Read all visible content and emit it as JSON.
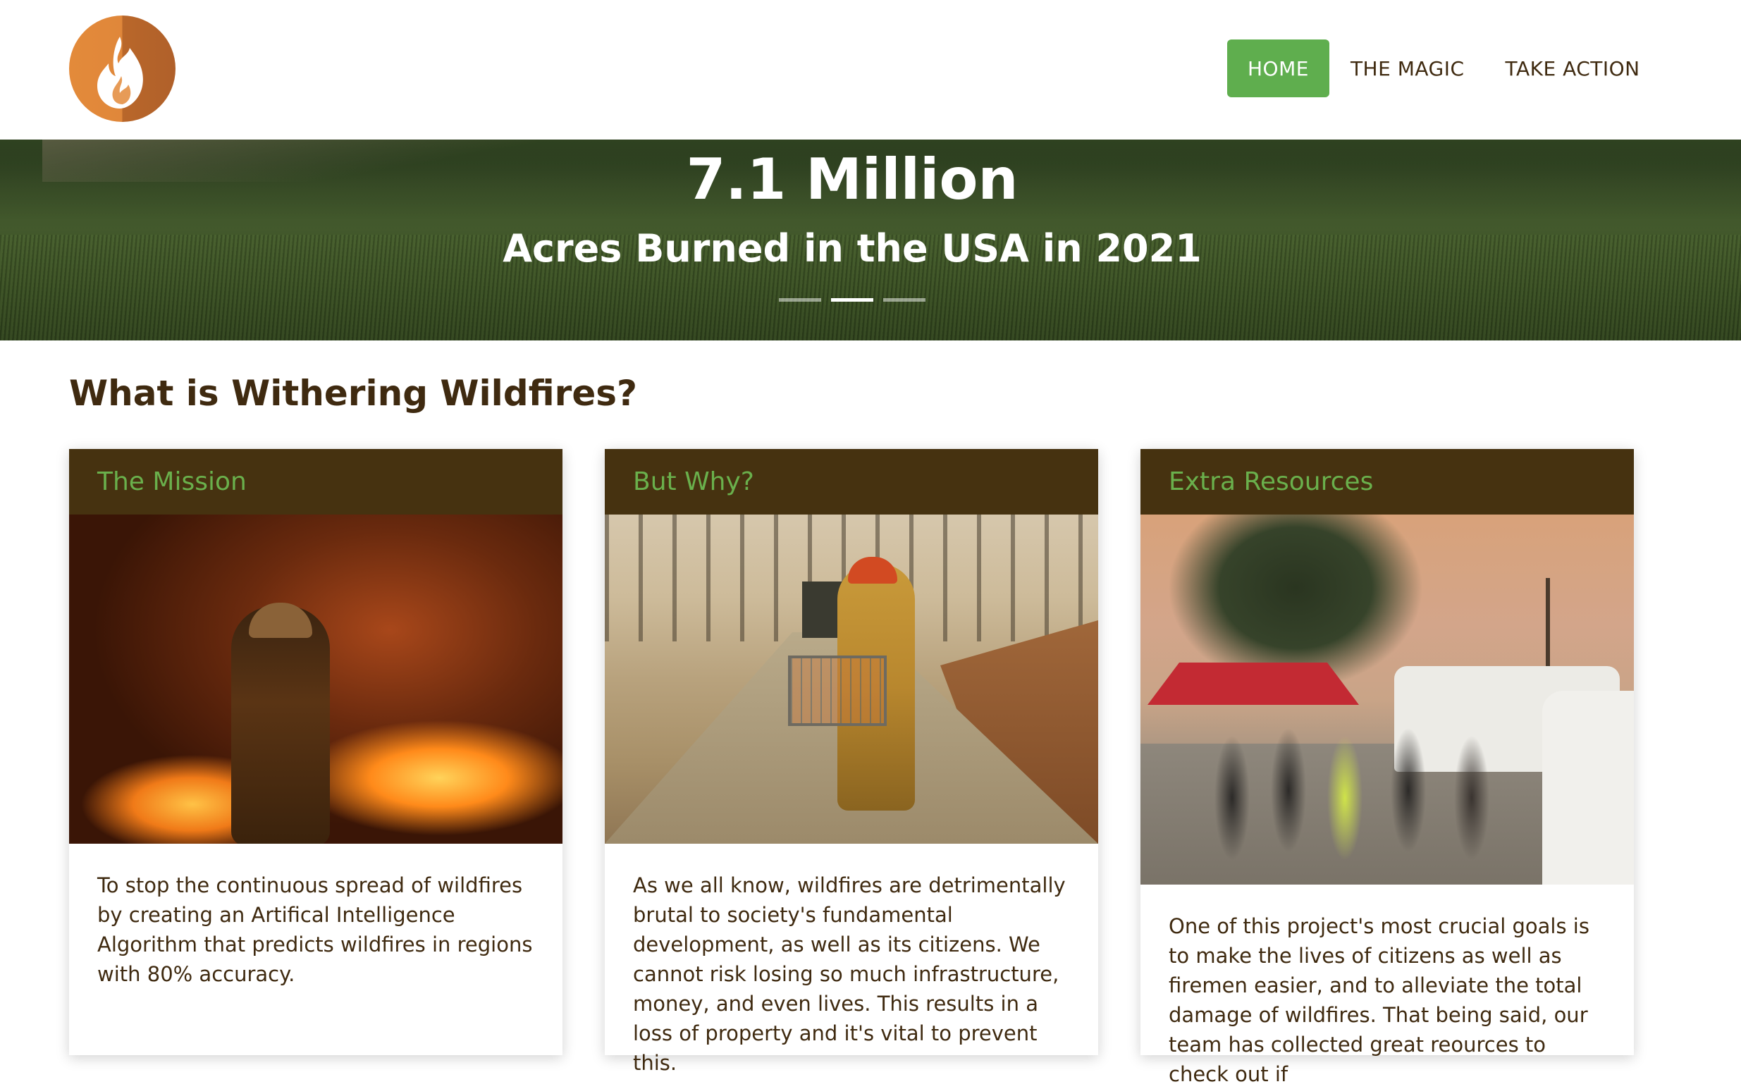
{
  "nav": {
    "logo_icon": "flame-icon",
    "links": [
      {
        "label": "HOME",
        "active": true
      },
      {
        "label": "THE MAGIC",
        "active": false
      },
      {
        "label": "TAKE ACTION",
        "active": false
      }
    ]
  },
  "hero": {
    "title": "7.1 Million",
    "subtitle": "Acres Burned in the USA in 2021",
    "slides_total": 3,
    "active_slide": 2
  },
  "section": {
    "heading": "What is Withering Wildfires?"
  },
  "cards": [
    {
      "title": "The Mission",
      "image": "firefighter-night-fire-photo",
      "text": "To stop the continuous spread of wildfires by creating an Artifical Intelligence Algorithm that predicts wildfires in regions with 80% accuracy."
    },
    {
      "title": "But Why?",
      "image": "firefighter-carrying-cage-photo",
      "text": "As we all know, wildfires are detrimentally brutal to society's fundamental development, as well as its citizens. We cannot risk losing so much infrastructure, money, and even lives. This results in a loss of property and it's vital to prevent this."
    },
    {
      "title": "Extra Resources",
      "image": "volunteer-aid-station-photo",
      "text": "One of this project's most crucial goals is to make the lives of citizens as well as firemen easier, and to alleviate the total damage of wildfires. That being said, our team has collected great reources to check out if"
    }
  ],
  "colors": {
    "accent_green": "#5fae4e",
    "card_header_brown": "#463210",
    "text_brown": "#3f2a10",
    "logo_orange": "#e38a3a"
  }
}
